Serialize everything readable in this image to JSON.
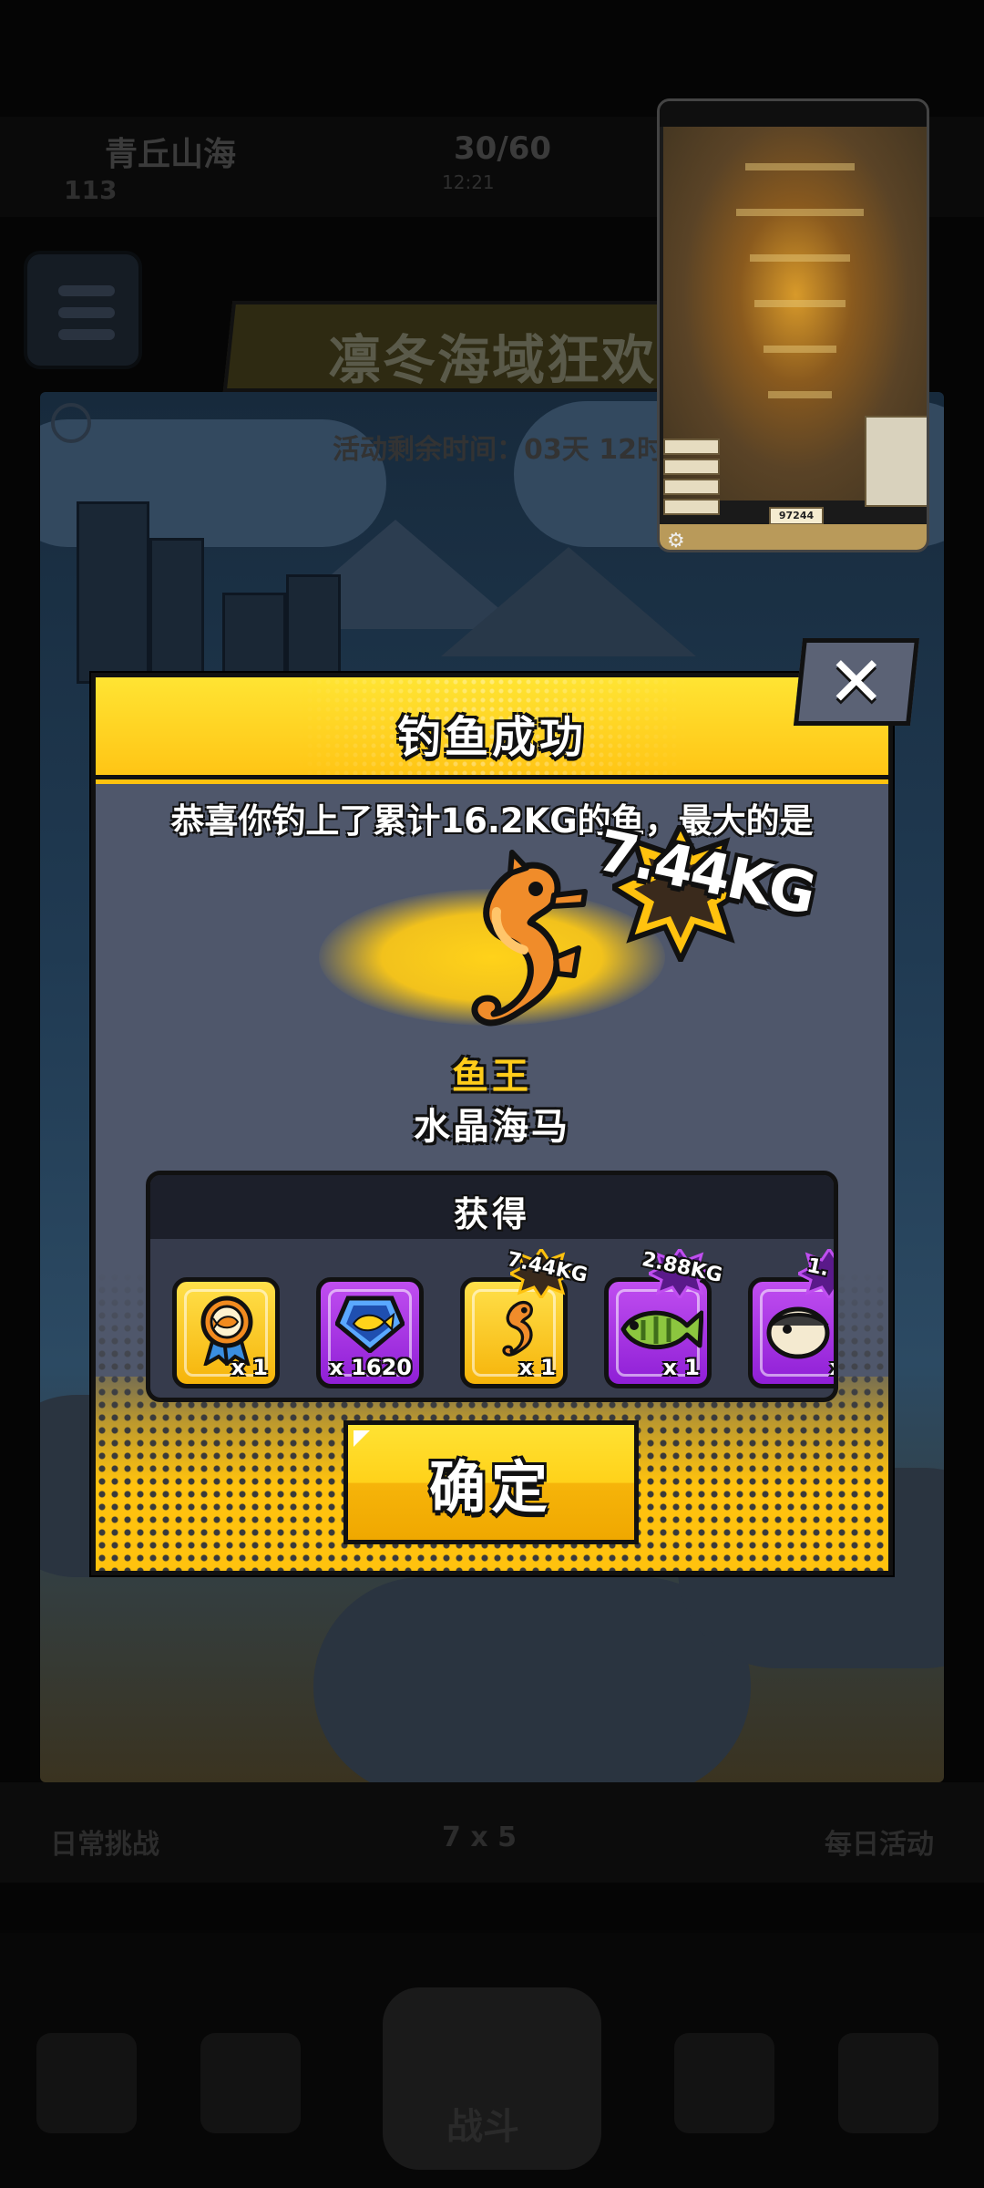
{
  "background": {
    "player_name": "青丘山海",
    "player_level": "113",
    "energy": "30/60",
    "energy_timer": "12:21",
    "event_title": "凛冬海域狂欢",
    "event_remaining": "活动剩余时间：03天 12时",
    "tabs": [
      "日常挑战",
      "7 x 5",
      "每日活动"
    ],
    "battle_label": "战斗"
  },
  "minimap": {
    "score": "97244"
  },
  "dialog": {
    "title": "钓鱼成功",
    "close_icon": "close-icon",
    "congrats_text": "恭喜你钓上了累计16.2KG的鱼，最大的是",
    "biggest_weight": "7.44KG",
    "fish_king_label": "鱼王",
    "fish_name": "水晶海马",
    "rewards_title": "获得",
    "rewards": [
      {
        "icon": "fish-medal-icon",
        "style": "gold",
        "qty": "x 1",
        "tag": ""
      },
      {
        "icon": "fish-coin-icon",
        "style": "purple",
        "qty": "x 1620",
        "tag": ""
      },
      {
        "icon": "seahorse-icon",
        "style": "gold",
        "qty": "x 1",
        "tag": "7.44KG"
      },
      {
        "icon": "green-fish-icon",
        "style": "purple",
        "qty": "x 1",
        "tag": "2.88KG"
      },
      {
        "icon": "pufferfish-icon",
        "style": "purple",
        "qty": "x",
        "tag": "1."
      }
    ],
    "confirm_label": "确定"
  },
  "colors": {
    "accent_yellow": "#ffc20e",
    "panel_slate": "#4f576b",
    "rare_purple": "#a22fe0",
    "fish_king_gold": "#ffcc1a"
  }
}
